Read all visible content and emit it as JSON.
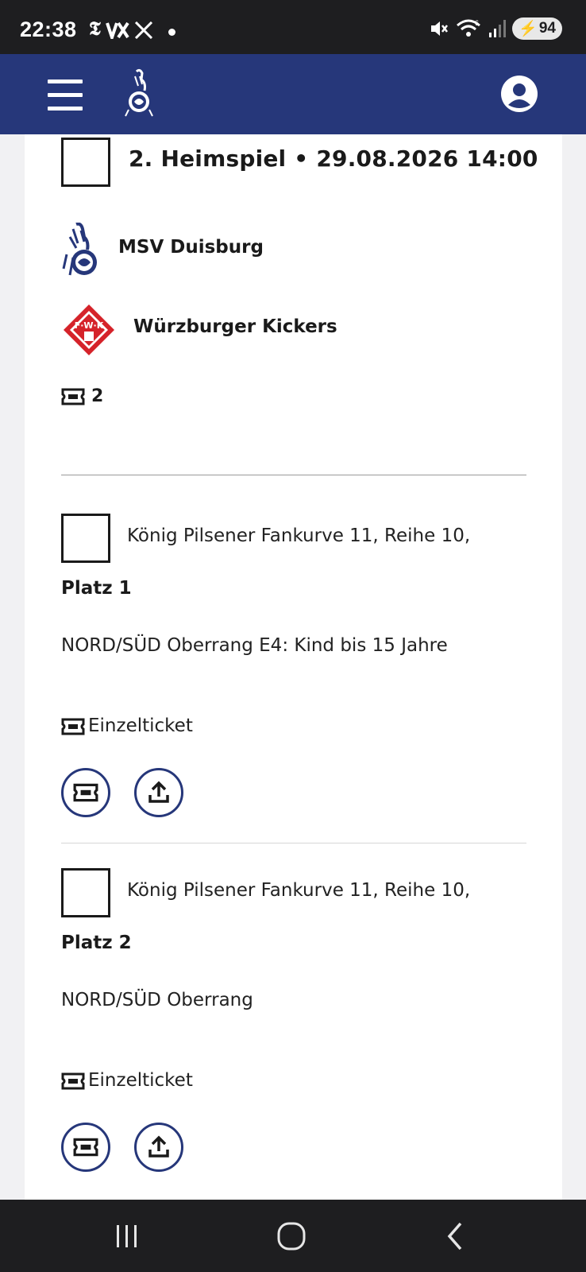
{
  "status_bar": {
    "time": "22:38",
    "app_icons": [
      "T",
      "VX",
      "X"
    ],
    "battery": "94",
    "icons": [
      "mute-icon",
      "wifi-icon",
      "signal-icon",
      "battery-icon"
    ]
  },
  "header": {
    "menu_icon": "hamburger-menu-icon",
    "logo_icon": "msv-zebra-logo",
    "account_icon": "account-icon",
    "background_color": "#26377a"
  },
  "match": {
    "title": "2. Heimspiel • 29.08.2026 14:00",
    "home_team": "MSV Duisburg",
    "away_team": "Würzburger Kickers",
    "away_logo_text": "F·W·K",
    "ticket_count": "2"
  },
  "seats": [
    {
      "line1": "König Pilsener Fankurve 11, Reihe 10,",
      "line2": "Platz 1",
      "category": "NORD/SÜD Oberrang E4: Kind bis 15 Jahre",
      "ticket_type": "Einzelticket"
    },
    {
      "line1": "König Pilsener Fankurve 11, Reihe 10,",
      "line2": "Platz 2",
      "category": "NORD/SÜD Oberrang",
      "ticket_type": "Einzelticket"
    }
  ],
  "nav": {
    "items": [
      "recent-apps-icon",
      "home-icon",
      "back-icon"
    ]
  }
}
